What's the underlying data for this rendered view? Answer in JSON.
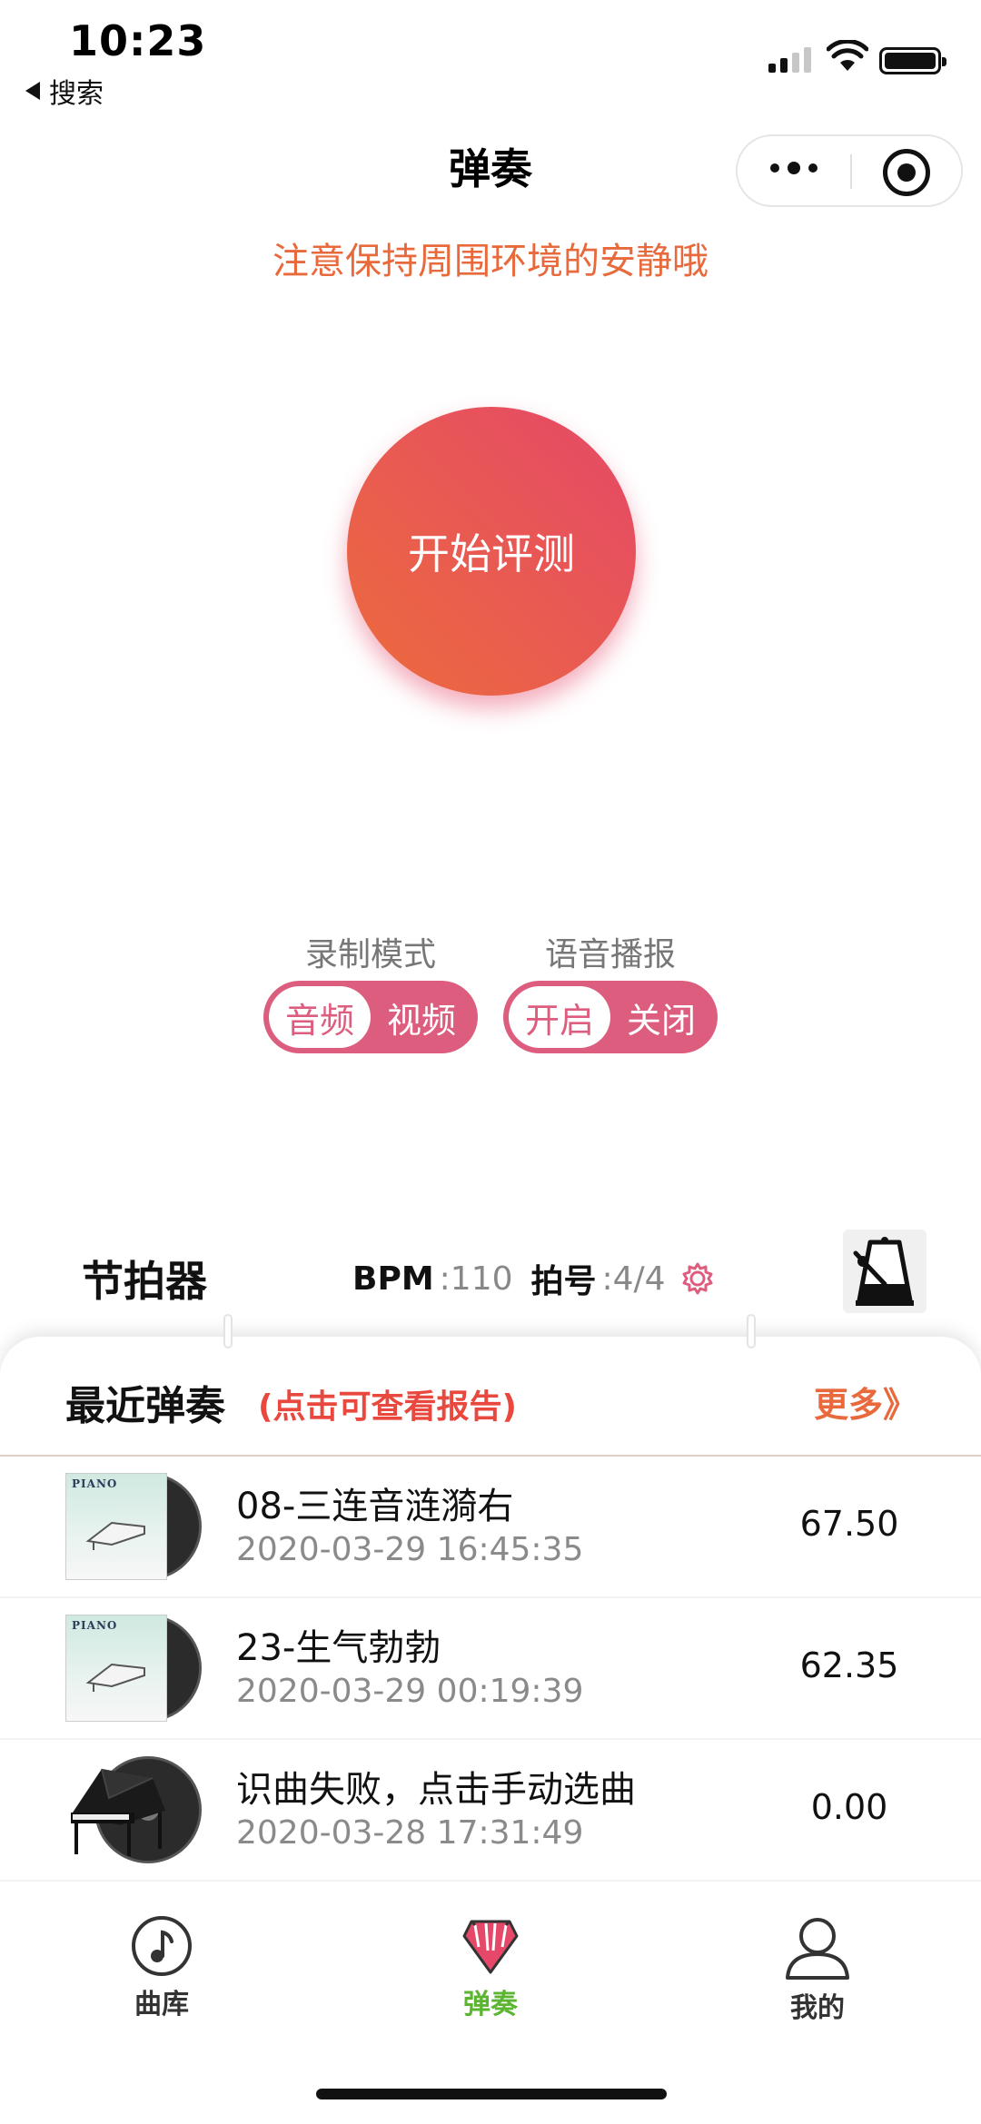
{
  "status_bar": {
    "time": "10:23",
    "back_label": "搜索"
  },
  "nav": {
    "title": "弹奏"
  },
  "notice": "注意保持周围环境的安静哦",
  "start_button": "开始评测",
  "record_mode": {
    "label": "录制模式",
    "options": [
      "音频",
      "视频"
    ],
    "selected": "音频"
  },
  "voice_broadcast": {
    "label": "语音播报",
    "options": [
      "开启",
      "关闭"
    ],
    "selected": "开启"
  },
  "metronome": {
    "title": "节拍器",
    "bpm_label": "BPM",
    "bpm_value": ":110",
    "beat_label": "拍号",
    "beat_value": ":4/4"
  },
  "recent": {
    "title": "最近弹奏",
    "hint": "(点击可查看报告)",
    "more": "更多》",
    "items": [
      {
        "name": "08-三连音涟漪右",
        "date": "2020-03-29 16:45:35",
        "score": "67.50",
        "cover": "piano-book-cover"
      },
      {
        "name": "23-生气勃勃",
        "date": "2020-03-29 00:19:39",
        "score": "62.35",
        "cover": "piano-book-cover"
      },
      {
        "name": "识曲失败，点击手动选曲",
        "date": "2020-03-28 17:31:49",
        "score": "0.00",
        "cover": "grand-piano-cover"
      }
    ],
    "cover_book_title": "PIANO"
  },
  "tabbar": {
    "items": [
      {
        "label": "曲库",
        "icon": "music-note-icon"
      },
      {
        "label": "弹奏",
        "icon": "piano-keys-icon",
        "active": true
      },
      {
        "label": "我的",
        "icon": "user-icon"
      }
    ]
  },
  "colors": {
    "accent": "#e54868",
    "orange": "#e86a3c",
    "toggle": "#dd5d7e",
    "active_tab": "#5cb530"
  }
}
